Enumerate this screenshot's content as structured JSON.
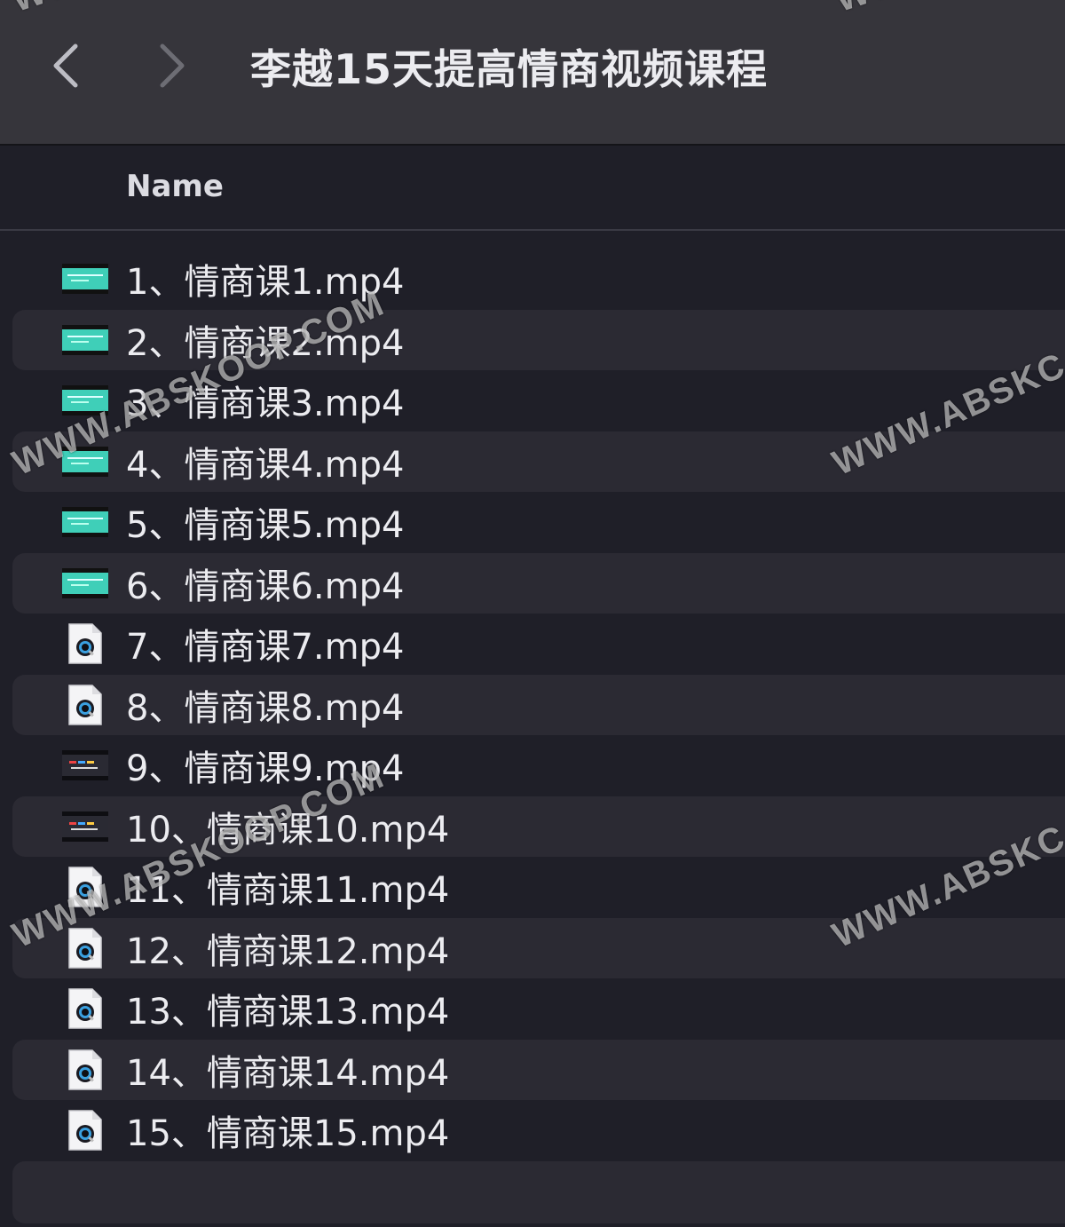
{
  "window": {
    "title": "李越15天提高情商视频课程"
  },
  "toolbar": {
    "back_icon": "chevron-left-icon",
    "forward_icon": "chevron-right-icon"
  },
  "list_header": {
    "name_column": "Name"
  },
  "files": [
    {
      "name": "1、情商课1.mp4",
      "icon": "video-thumbnail-teal-icon"
    },
    {
      "name": "2、情商课2.mp4",
      "icon": "video-thumbnail-teal-icon"
    },
    {
      "name": "3、情商课3.mp4",
      "icon": "video-thumbnail-teal-icon"
    },
    {
      "name": "4、情商课4.mp4",
      "icon": "video-thumbnail-teal-icon"
    },
    {
      "name": "5、情商课5.mp4",
      "icon": "video-thumbnail-teal-icon"
    },
    {
      "name": "6、情商课6.mp4",
      "icon": "video-thumbnail-teal-icon"
    },
    {
      "name": "7、情商课7.mp4",
      "icon": "quicktime-document-icon"
    },
    {
      "name": "8、情商课8.mp4",
      "icon": "quicktime-document-icon"
    },
    {
      "name": "9、情商课9.mp4",
      "icon": "video-thumbnail-dark-icon"
    },
    {
      "name": "10、情商课10.mp4",
      "icon": "video-thumbnail-dark-icon"
    },
    {
      "name": "11、情商课11.mp4",
      "icon": "quicktime-document-icon"
    },
    {
      "name": "12、情商课12.mp4",
      "icon": "quicktime-document-icon"
    },
    {
      "name": "13、情商课13.mp4",
      "icon": "quicktime-document-icon"
    },
    {
      "name": "14、情商课14.mp4",
      "icon": "quicktime-document-icon"
    },
    {
      "name": "15、情商课15.mp4",
      "icon": "quicktime-document-icon"
    }
  ],
  "watermarks": [
    "WWW.ABSKOOP.COM",
    "WWW.ABSKC",
    "WWW.ABSKOOP.COM",
    "WWW.ABSKC",
    "WW",
    "WW"
  ],
  "colors": {
    "titlebar_bg": "#36353b",
    "list_bg": "#1f1f28",
    "row_alt_bg": "#2b2a33",
    "text": "#ececf0",
    "teal_thumb": "#3fcfb8"
  }
}
